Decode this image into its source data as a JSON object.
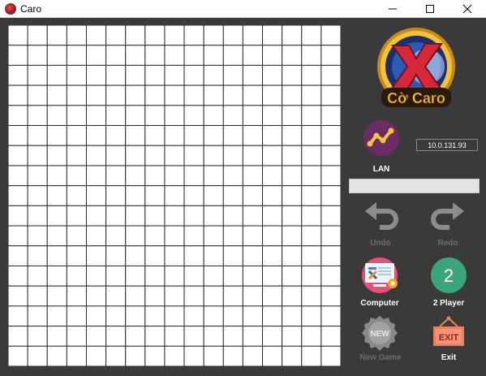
{
  "window": {
    "title": "Caro"
  },
  "logo": {
    "text": "Cờ Caro"
  },
  "lan": {
    "label": "LAN",
    "ip_value": "10.0.131.93"
  },
  "buttons": {
    "undo": "Undo",
    "redo": "Redo",
    "computer": "Computer",
    "two_player": "2 Player",
    "two_player_icon_text": "2",
    "new_game": "New Game",
    "new_game_icon_text": "NEW",
    "exit": "Exit",
    "exit_icon_text": "EXIT"
  },
  "board": {
    "columns": 17,
    "rows": 17
  },
  "colors": {
    "background": "#3a3a3a",
    "two_player": "#3aa67c",
    "lan": "#6b2c63",
    "exit": "#ef7c5b"
  },
  "icons": [
    "app-icon",
    "minimize-icon",
    "maximize-icon",
    "close-icon",
    "caro-logo-icon",
    "lan-icon",
    "undo-icon",
    "redo-icon",
    "computer-icon",
    "two-player-icon",
    "new-game-icon",
    "exit-icon"
  ]
}
